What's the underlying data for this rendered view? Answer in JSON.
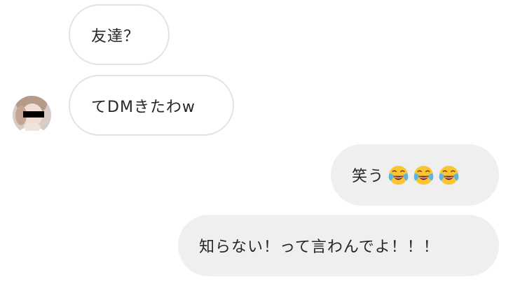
{
  "messages": [
    {
      "direction": "incoming",
      "text": "友達？"
    },
    {
      "direction": "incoming",
      "text": "てDMきたわw"
    },
    {
      "direction": "outgoing",
      "text": "笑う",
      "emoji": [
        "face-with-tears-of-joy-icon",
        "face-with-tears-of-joy-icon",
        "face-with-tears-of-joy-icon"
      ]
    },
    {
      "direction": "outgoing",
      "text": "知らない！って言わんでよ！！！"
    }
  ],
  "colors": {
    "incoming_bg": "#ffffff",
    "incoming_border": "#e3e3e3",
    "outgoing_bg": "#efefef",
    "text": "#262626"
  }
}
